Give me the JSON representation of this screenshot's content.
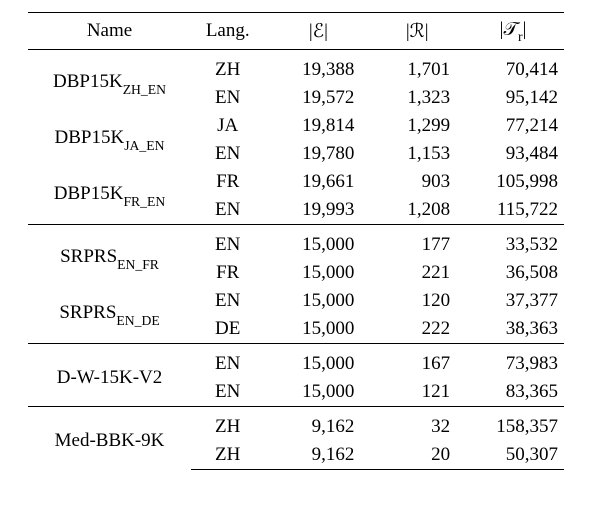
{
  "chart_data": {
    "type": "table",
    "columns": [
      "Name",
      "Lang.",
      "|E|",
      "|R|",
      "|T_r|"
    ],
    "rows": [
      {
        "name": "DBP15K_ZH_EN",
        "lang": "ZH",
        "E": 19388,
        "R": 1701,
        "Tr": 70414
      },
      {
        "name": "DBP15K_ZH_EN",
        "lang": "EN",
        "E": 19572,
        "R": 1323,
        "Tr": 95142
      },
      {
        "name": "DBP15K_JA_EN",
        "lang": "JA",
        "E": 19814,
        "R": 1299,
        "Tr": 77214
      },
      {
        "name": "DBP15K_JA_EN",
        "lang": "EN",
        "E": 19780,
        "R": 1153,
        "Tr": 93484
      },
      {
        "name": "DBP15K_FR_EN",
        "lang": "FR",
        "E": 19661,
        "R": 903,
        "Tr": 105998
      },
      {
        "name": "DBP15K_FR_EN",
        "lang": "EN",
        "E": 19993,
        "R": 1208,
        "Tr": 115722
      },
      {
        "name": "SRPRS_EN_FR",
        "lang": "EN",
        "E": 15000,
        "R": 177,
        "Tr": 33532
      },
      {
        "name": "SRPRS_EN_FR",
        "lang": "FR",
        "E": 15000,
        "R": 221,
        "Tr": 36508
      },
      {
        "name": "SRPRS_EN_DE",
        "lang": "EN",
        "E": 15000,
        "R": 120,
        "Tr": 37377
      },
      {
        "name": "SRPRS_EN_DE",
        "lang": "DE",
        "E": 15000,
        "R": 222,
        "Tr": 38363
      },
      {
        "name": "D-W-15K-V2",
        "lang": "EN",
        "E": 15000,
        "R": 167,
        "Tr": 73983
      },
      {
        "name": "D-W-15K-V2",
        "lang": "EN",
        "E": 15000,
        "R": 121,
        "Tr": 83365
      },
      {
        "name": "Med-BBK-9K",
        "lang": "ZH",
        "E": 9162,
        "R": 32,
        "Tr": 158357
      },
      {
        "name": "Med-BBK-9K",
        "lang": "ZH",
        "E": 9162,
        "R": 20,
        "Tr": 50307
      }
    ]
  },
  "header": {
    "name": "Name",
    "lang": "Lang.",
    "E": "|ℰ|",
    "R": "|ℛ|",
    "Tr_open": "|𝒯",
    "Tr_sub": "r",
    "Tr_close": "|"
  },
  "names": {
    "dbp15k_base": "DBP15K",
    "dbp15k_zh_sub": "ZH_EN",
    "dbp15k_ja_sub": "JA_EN",
    "dbp15k_fr_sub": "FR_EN",
    "srprs_base": "SRPRS",
    "srprs_fr_sub": "EN_FR",
    "srprs_de_sub": "EN_DE",
    "dw15k": "D-W-15K-V2",
    "medbbk": "Med-BBK-9K"
  },
  "rows": [
    {
      "lang": "ZH",
      "E": "19,388",
      "R": "1,701",
      "Tr": "70,414"
    },
    {
      "lang": "EN",
      "E": "19,572",
      "R": "1,323",
      "Tr": "95,142"
    },
    {
      "lang": "JA",
      "E": "19,814",
      "R": "1,299",
      "Tr": "77,214"
    },
    {
      "lang": "EN",
      "E": "19,780",
      "R": "1,153",
      "Tr": "93,484"
    },
    {
      "lang": "FR",
      "E": "19,661",
      "R": "903",
      "Tr": "105,998"
    },
    {
      "lang": "EN",
      "E": "19,993",
      "R": "1,208",
      "Tr": "115,722"
    },
    {
      "lang": "EN",
      "E": "15,000",
      "R": "177",
      "Tr": "33,532"
    },
    {
      "lang": "FR",
      "E": "15,000",
      "R": "221",
      "Tr": "36,508"
    },
    {
      "lang": "EN",
      "E": "15,000",
      "R": "120",
      "Tr": "37,377"
    },
    {
      "lang": "DE",
      "E": "15,000",
      "R": "222",
      "Tr": "38,363"
    },
    {
      "lang": "EN",
      "E": "15,000",
      "R": "167",
      "Tr": "73,983"
    },
    {
      "lang": "EN",
      "E": "15,000",
      "R": "121",
      "Tr": "83,365"
    },
    {
      "lang": "ZH",
      "E": "9,162",
      "R": "32",
      "Tr": "158,357"
    },
    {
      "lang": "ZH",
      "E": "9,162",
      "R": "20",
      "Tr": "50,307"
    }
  ]
}
